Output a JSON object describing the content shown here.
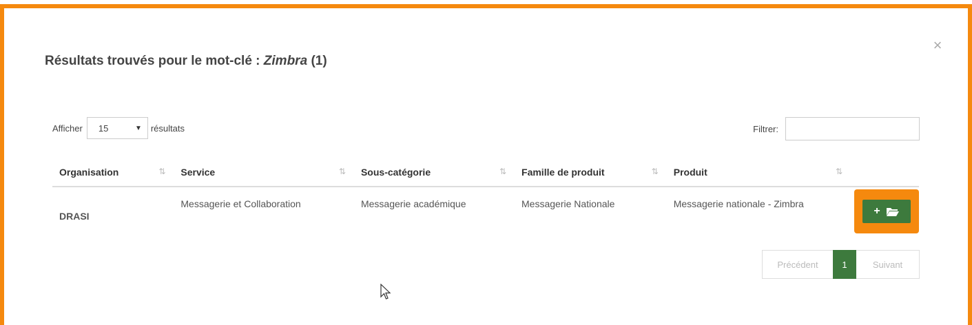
{
  "modal": {
    "title_prefix": "Résultats trouvés pour le mot-clé :",
    "keyword": "Zimbra",
    "count": "(1)",
    "close_label": "×"
  },
  "controls": {
    "show_label": "Afficher",
    "page_size": "15",
    "results_label": "résultats",
    "filter_label": "Filtrer:",
    "filter_value": ""
  },
  "table": {
    "headers": [
      "Organisation",
      "Service",
      "Sous-catégorie",
      "Famille de produit",
      "Produit"
    ],
    "sort_icon": "⇅",
    "rows": [
      {
        "organisation": "DRASI",
        "service": "Messagerie et Collaboration",
        "sous_categorie": "Messagerie académique",
        "famille": "Messagerie Nationale",
        "produit": "Messagerie nationale - Zimbra"
      }
    ]
  },
  "action": {
    "plus_glyph": "+",
    "folder_icon": "folder-open-icon"
  },
  "pagination": {
    "prev": "Précédent",
    "current": "1",
    "next": "Suivant"
  },
  "colors": {
    "highlight": "#f5890e",
    "accent_green": "#3d7a3d"
  }
}
